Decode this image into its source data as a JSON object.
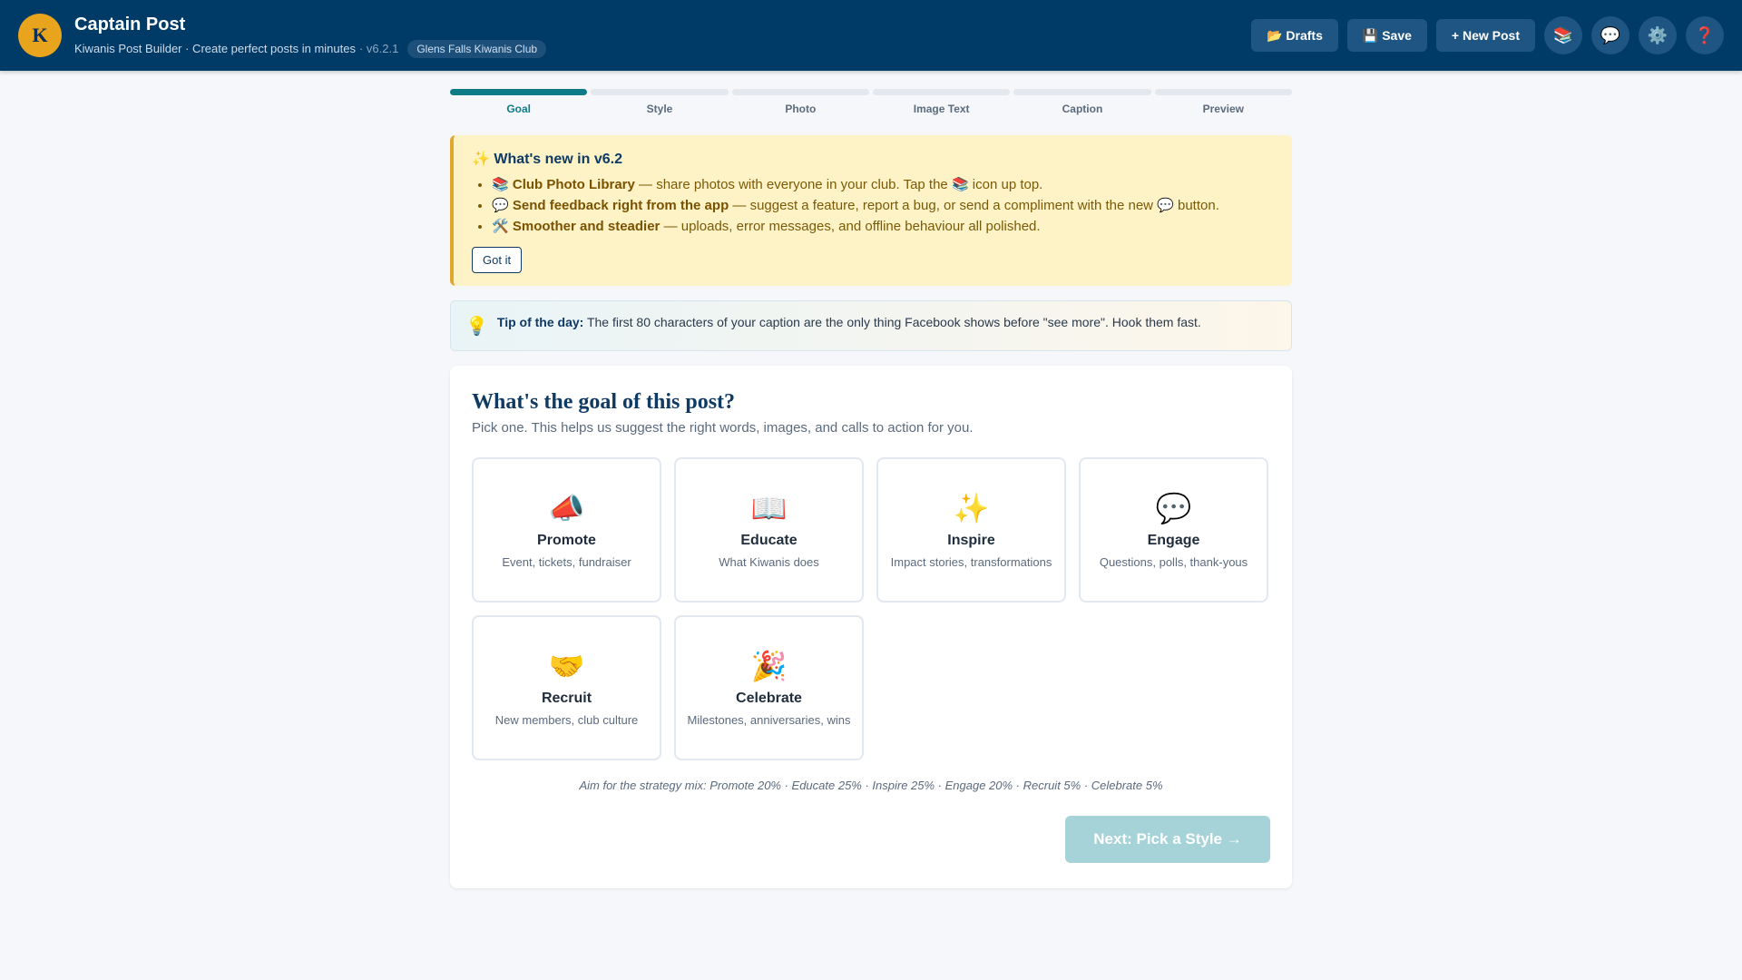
{
  "header": {
    "logo_letter": "K",
    "title": "Captain Post",
    "subtitle": "Kiwanis Post Builder · Create perfect posts in minutes",
    "version": "· v6.2.1",
    "club": "Glens Falls Kiwanis Club",
    "drafts_label": "📂 Drafts",
    "save_label": "💾 Save",
    "new_post_label": "+ New Post",
    "library_icon": "📚",
    "feedback_icon": "💬",
    "settings_icon": "⚙️",
    "help_icon": "❓"
  },
  "steps": [
    {
      "label": "Goal",
      "active": true
    },
    {
      "label": "Style",
      "active": false
    },
    {
      "label": "Photo",
      "active": false
    },
    {
      "label": "Image Text",
      "active": false
    },
    {
      "label": "Caption",
      "active": false
    },
    {
      "label": "Preview",
      "active": false
    }
  ],
  "whats_new": {
    "title": "✨ What's new in v6.2",
    "items": [
      {
        "prefix": "📚 ",
        "bold": "Club Photo Library",
        "rest": " — share photos with everyone in your club. Tap the 📚 icon up top."
      },
      {
        "prefix": "💬 ",
        "bold": "Send feedback right from the app",
        "rest": " — suggest a feature, report a bug, or send a compliment with the new 💬 button."
      },
      {
        "prefix": "🛠️ ",
        "bold": "Smoother and steadier",
        "rest": " — uploads, error messages, and offline behaviour all polished."
      }
    ],
    "dismiss_label": "Got it"
  },
  "tip": {
    "icon": "💡",
    "label": "Tip of the day:",
    "text": " The first 80 characters of your caption are the only thing Facebook shows before \"see more\". Hook them fast."
  },
  "goal_card": {
    "title": "What's the goal of this post?",
    "subtitle": "Pick one. This helps us suggest the right words, images, and calls to action for you.",
    "goals": [
      {
        "icon": "📣",
        "name": "Promote",
        "desc": "Event, tickets, fundraiser"
      },
      {
        "icon": "📖",
        "name": "Educate",
        "desc": "What Kiwanis does"
      },
      {
        "icon": "✨",
        "name": "Inspire",
        "desc": "Impact stories, transformations"
      },
      {
        "icon": "💬",
        "name": "Engage",
        "desc": "Questions, polls, thank-yous"
      },
      {
        "icon": "🤝",
        "name": "Recruit",
        "desc": "New members, club culture"
      },
      {
        "icon": "🎉",
        "name": "Celebrate",
        "desc": "Milestones, anniversaries, wins"
      }
    ],
    "strategy_mix": "Aim for the strategy mix: Promote 20% · Educate 25% · Inspire 25% · Engage 20% · Recruit 5% · Celebrate 5%",
    "next_label": "Next: Pick a Style →"
  },
  "colors": {
    "header_bg": "#003a66",
    "accent_teal": "#0e7c86",
    "gold": "#e8a41c"
  }
}
